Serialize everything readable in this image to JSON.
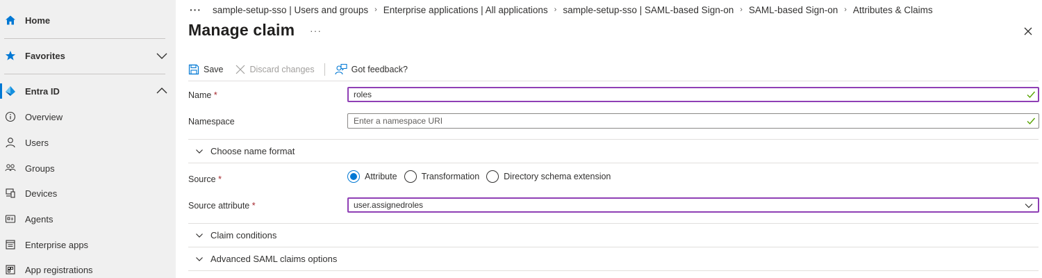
{
  "sidebar": {
    "items": [
      {
        "label": "Home",
        "icon": "home-icon"
      },
      {
        "label": "Favorites",
        "icon": "star-icon"
      },
      {
        "label": "Entra ID",
        "icon": "entra-id-icon"
      },
      {
        "label": "Overview",
        "icon": "info-icon"
      },
      {
        "label": "Users",
        "icon": "user-icon"
      },
      {
        "label": "Groups",
        "icon": "groups-icon"
      },
      {
        "label": "Devices",
        "icon": "devices-icon"
      },
      {
        "label": "Agents",
        "icon": "agents-icon"
      },
      {
        "label": "Enterprise apps",
        "icon": "enterprise-apps-icon"
      },
      {
        "label": "App registrations",
        "icon": "app-registrations-icon"
      }
    ]
  },
  "breadcrumb": {
    "more": "···",
    "items": [
      "sample-setup-sso | Users and groups",
      "Enterprise applications | All applications",
      "sample-setup-sso | SAML-based Sign-on",
      "SAML-based Sign-on",
      "Attributes & Claims"
    ]
  },
  "page": {
    "title": "Manage claim",
    "more": "···"
  },
  "toolbar": {
    "save_label": "Save",
    "discard_label": "Discard changes",
    "feedback_label": "Got feedback?"
  },
  "form": {
    "name_label": "Name",
    "required_mark": "*",
    "name_value": "roles",
    "namespace_label": "Namespace",
    "namespace_placeholder": "Enter a namespace URI",
    "name_format_label": "Choose name format",
    "source_label": "Source",
    "source_options": [
      "Attribute",
      "Transformation",
      "Directory schema extension"
    ],
    "source_selected": "Attribute",
    "source_attribute_label": "Source attribute",
    "source_attribute_value": "user.assignedroles",
    "claim_conditions_label": "Claim conditions",
    "advanced_label": "Advanced SAML claims options"
  },
  "colors": {
    "accent": "#0078d4",
    "focus_border": "#8f3fb5",
    "valid_check": "#57a300",
    "required": "#a4262c"
  }
}
